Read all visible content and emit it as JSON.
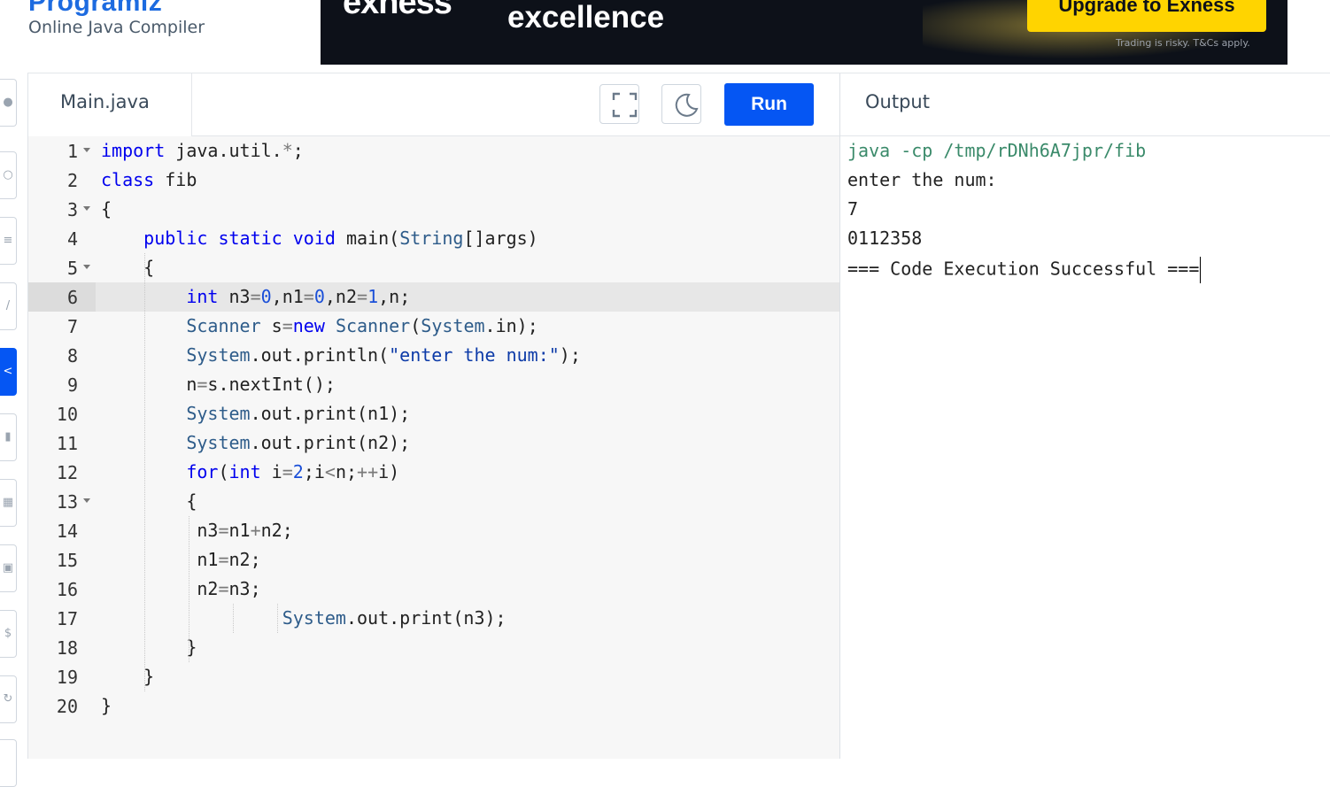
{
  "header": {
    "title": "Programiz",
    "subtitle": "Online Java Compiler"
  },
  "ad": {
    "brand": "exness",
    "tagline": "excellence",
    "cta": "Upgrade to Exness",
    "disclaimer": "Trading is risky. T&Cs apply.",
    "accent": "#ffd400"
  },
  "rail": {
    "items": [
      "python-icon",
      "search-icon",
      "file-icon",
      "edit-icon",
      "java-icon",
      "code-icon",
      "html-icon",
      "js-icon",
      "dollar-icon",
      "link-icon"
    ],
    "active_index": 4
  },
  "editor": {
    "filename": "Main.java",
    "run_label": "Run",
    "fullscreen_icon": "fullscreen-icon",
    "theme_icon": "moon-icon",
    "active_line": 6,
    "lines": [
      {
        "num": "1",
        "text": "import java.util.*;"
      },
      {
        "num": "2",
        "text": "class fib"
      },
      {
        "num": "3",
        "text": "{"
      },
      {
        "num": "4",
        "text": "    public static void main(String[]args)"
      },
      {
        "num": "5",
        "text": "    {"
      },
      {
        "num": "6",
        "text": "        int n3=0,n1=0,n2=1,n;"
      },
      {
        "num": "7",
        "text": "        Scanner s=new Scanner(System.in);"
      },
      {
        "num": "8",
        "text": "        System.out.println(\"enter the num:\");"
      },
      {
        "num": "9",
        "text": "        n=s.nextInt();"
      },
      {
        "num": "10",
        "text": "        System.out.print(n1);"
      },
      {
        "num": "11",
        "text": "        System.out.print(n2);"
      },
      {
        "num": "12",
        "text": "        for(int i=2;i<n;++i)"
      },
      {
        "num": "13",
        "text": "        {"
      },
      {
        "num": "14",
        "text": "         n3=n1+n2;"
      },
      {
        "num": "15",
        "text": "         n1=n2;"
      },
      {
        "num": "16",
        "text": "         n2=n3;"
      },
      {
        "num": "17",
        "text": "                 System.out.print(n3);"
      },
      {
        "num": "18",
        "text": "        }"
      },
      {
        "num": "19",
        "text": "    }"
      },
      {
        "num": "20",
        "text": "}"
      }
    ]
  },
  "output": {
    "title": "Output",
    "lines": [
      "java -cp /tmp/rDNh6A7jpr/fib",
      "enter the num:",
      "7",
      "0112358",
      "=== Code Execution Successful ==="
    ]
  }
}
